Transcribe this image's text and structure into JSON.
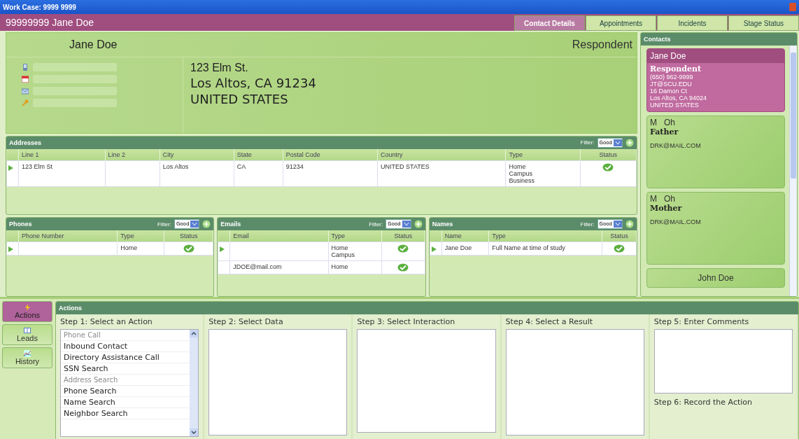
{
  "window": {
    "title": "Work Case: 9999 9999"
  },
  "header": {
    "title": "99999999 Jane Doe"
  },
  "tabs": [
    {
      "label": "Contact Details",
      "selected": true
    },
    {
      "label": "Appointments",
      "selected": false
    },
    {
      "label": "Incidents",
      "selected": false
    },
    {
      "label": "Stage Status",
      "selected": false
    }
  ],
  "person": {
    "name": "Jane Doe",
    "role": "Respondent",
    "info_rows": [
      {
        "kind": "phone"
      },
      {
        "kind": "calendar"
      },
      {
        "kind": "email"
      },
      {
        "kind": "key"
      }
    ],
    "address": [
      "123 Elm St.",
      "Los Altos, CA  91234",
      "UNITED STATES"
    ]
  },
  "addresses": {
    "title": "Addresses",
    "filter_label": "Filter:",
    "filter": "Good",
    "columns": [
      "Line 1",
      "Line 2",
      "City",
      "State",
      "Postal Code",
      "Country",
      "Type",
      "Status"
    ],
    "rows": [
      {
        "current": true,
        "cells": [
          "123 Elm St",
          "",
          "Los Altos",
          "CA",
          "91234",
          "UNITED STATES",
          "Home\nCampus\nBusiness"
        ],
        "verified": true
      }
    ]
  },
  "panels": [
    {
      "title": "Phones",
      "filter_label": "Filter:",
      "filter": "Good",
      "columns": [
        "Phone Number",
        "Type",
        "Status"
      ],
      "rows": [
        {
          "current": true,
          "cells": [
            "",
            "Home"
          ],
          "verified": true
        }
      ]
    },
    {
      "title": "Emails",
      "filter_label": "Filter:",
      "filter": "Good",
      "columns": [
        "Email",
        "Type",
        "Status"
      ],
      "rows": [
        {
          "current": true,
          "cells": [
            "",
            "Home\nCampus"
          ],
          "verified": true
        },
        {
          "current": false,
          "cells": [
            "JDOE@mail.com",
            "Home"
          ],
          "verified": true
        }
      ]
    },
    {
      "title": "Names",
      "filter_label": "Filter:",
      "filter": "Good",
      "columns": [
        "Name",
        "Type",
        "Status"
      ],
      "rows": [
        {
          "current": true,
          "cells": [
            "Jane Doe",
            "Full Name at time of study"
          ],
          "verified": true
        }
      ]
    }
  ],
  "contacts": {
    "title": "Contacts",
    "items": [
      {
        "name": "Jane Doe",
        "role": "Respondent",
        "lines": [
          "(650) 962-9999",
          "JT@SCU.EDU",
          "16 Damon Ct",
          "Los Altos, CA 94024",
          "UNITED STATES"
        ],
        "selected": true
      },
      {
        "name": "M   Oh",
        "role": "Father",
        "lines": [
          "DRK@MAIL.COM"
        ],
        "selected": false
      },
      {
        "name": "M   Oh",
        "role": "Mother",
        "lines": [
          "DRK@MAIL.COM"
        ],
        "selected": false
      },
      {
        "name": "John Doe",
        "selected": false
      }
    ]
  },
  "nav": [
    {
      "label": "Actions",
      "kind": "actions",
      "selected": true
    },
    {
      "label": "Leads",
      "kind": "leads",
      "selected": false
    },
    {
      "label": "History",
      "kind": "history",
      "selected": false
    }
  ],
  "actions": {
    "title": "Actions",
    "steps": [
      {
        "label": "Step 1:  Select an Action",
        "kind": "list",
        "items": [
          {
            "label": "Phone Call",
            "disabled": true
          },
          {
            "label": "Inbound Contact",
            "disabled": false
          },
          {
            "label": "Directory Assistance Call",
            "disabled": false
          },
          {
            "label": "SSN Search",
            "disabled": false
          },
          {
            "label": "Address Search",
            "disabled": true
          },
          {
            "label": "Phone Search",
            "disabled": false
          },
          {
            "label": "Name Search",
            "disabled": false
          },
          {
            "label": "Neighbor Search",
            "disabled": false
          }
        ]
      },
      {
        "label": "Step 2: Select Data",
        "kind": "box"
      },
      {
        "label": "Step 3: Select Interaction",
        "kind": "short"
      },
      {
        "label": "Step 4: Select a Result",
        "kind": "box"
      },
      {
        "label": "Step 5: Enter Comments",
        "kind": "comments",
        "note": "Step 6: Record the Action"
      }
    ]
  }
}
